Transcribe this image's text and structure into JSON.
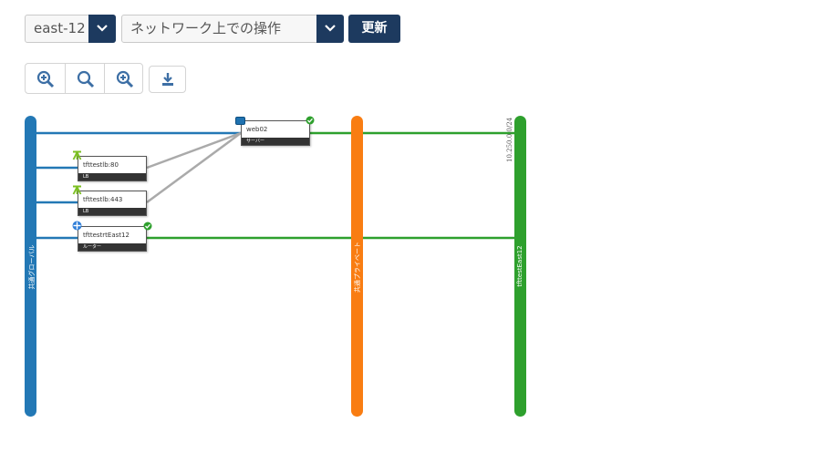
{
  "toolbar": {
    "region_select": "east-12",
    "operation_select": "ネットワーク上での操作",
    "update_button": "更新"
  },
  "zoom_controls": {
    "icons": [
      "zoom-in-icon",
      "zoom-reset-icon",
      "zoom-out-icon",
      "download-icon"
    ]
  },
  "networks": [
    {
      "name": "共通グローバル",
      "color": "#2378b5"
    },
    {
      "name": "共通プライベート",
      "color": "#f97d12"
    },
    {
      "name": "tfttestEast12",
      "color": "#2ea02d"
    }
  ],
  "subnet_label": "10.250.0.0/24",
  "nodes": [
    {
      "name": "web02",
      "type": "サーバー"
    },
    {
      "name": "tfttestlb:80",
      "type": "LB"
    },
    {
      "name": "tfttestlb:443",
      "type": "LB"
    },
    {
      "name": "tfttestrtEast12",
      "type": "ルーター"
    }
  ],
  "colors": {
    "accent": "#1d3a5f",
    "link_gray": "#aaaaaa",
    "status_ok": "#2ea02d"
  }
}
